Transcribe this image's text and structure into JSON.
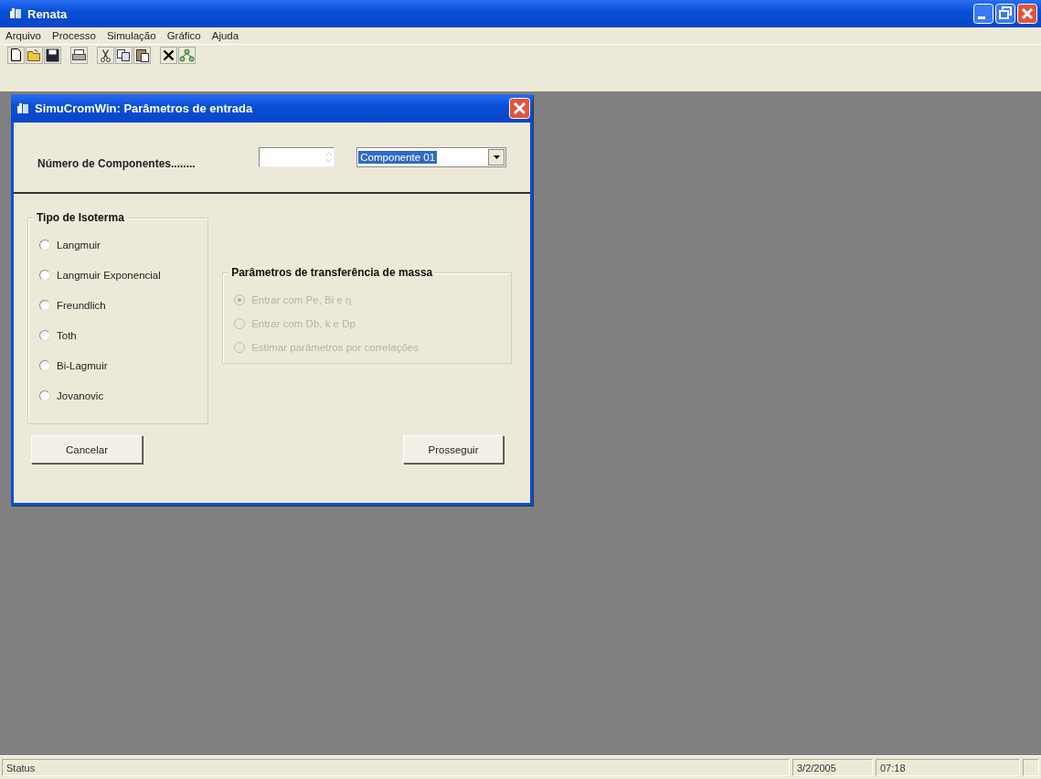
{
  "window": {
    "title": "Renata"
  },
  "menu": [
    "Arquivo",
    "Processo",
    "Simulação",
    "Gráfico",
    "Ajuda"
  ],
  "dialog": {
    "title": "SimuCromWin: Parâmetros de entrada",
    "components_label": "Número de Componentes........",
    "component_select": {
      "value": "Componente 01"
    },
    "isotherm_group": {
      "title": "Tipo de Isoterma",
      "options": [
        {
          "label": "Langmuir",
          "selected": false,
          "disabled": false
        },
        {
          "label": "Langmuir Exponencial",
          "selected": false,
          "disabled": false
        },
        {
          "label": "Freundlich",
          "selected": false,
          "disabled": false
        },
        {
          "label": "Toth",
          "selected": false,
          "disabled": false
        },
        {
          "label": "Bi-Lagmuir",
          "selected": false,
          "disabled": false
        },
        {
          "label": "Jovanovic",
          "selected": false,
          "disabled": false
        }
      ]
    },
    "mass_transfer_group": {
      "title": "Parâmetros de transferência de massa",
      "options": [
        {
          "label": "Entrar com Pe, Bi e η",
          "selected": true,
          "disabled": true
        },
        {
          "label": "Entrar com Db, k e Dp",
          "selected": false,
          "disabled": true
        },
        {
          "label": "Estimar parâmetros por correlações",
          "selected": false,
          "disabled": true
        }
      ]
    },
    "buttons": [
      "Cancelar",
      "Prosseguir"
    ]
  },
  "status_bar": {
    "status": "Status",
    "date": "3/2/2005",
    "time": "07:18"
  }
}
